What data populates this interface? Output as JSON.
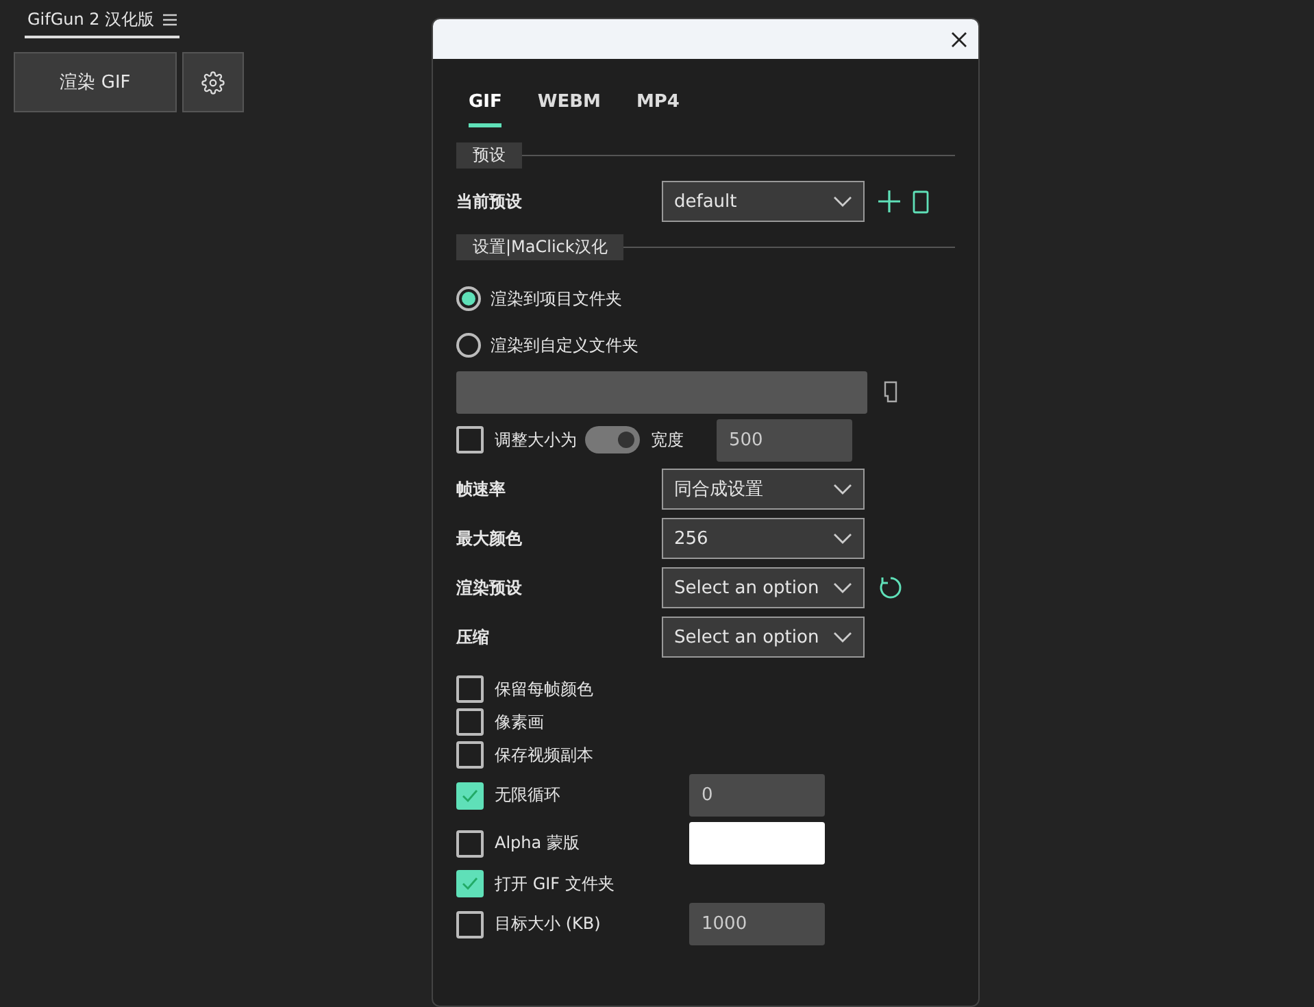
{
  "app": {
    "title": "GifGun 2 汉化版",
    "render_button": "渲染 GIF"
  },
  "dialog": {
    "tabs": [
      {
        "label": "GIF",
        "selected": true
      },
      {
        "label": "WEBM",
        "selected": false
      },
      {
        "label": "MP4",
        "selected": false
      }
    ],
    "preset_section": {
      "heading": "预设",
      "label": "当前预设",
      "value": "default"
    },
    "settings_section": {
      "heading": "设置|MaClick汉化"
    },
    "output": [
      {
        "label": "渲染到项目文件夹",
        "selected": true
      },
      {
        "label": "渲染到自定义文件夹",
        "selected": false
      }
    ],
    "resize": {
      "label": "调整大小为",
      "checked": false,
      "switch_on": true,
      "width_label": "宽度",
      "width_value": "500"
    },
    "selects": [
      {
        "label": "帧速率",
        "value": "同合成设置",
        "kind": "select"
      },
      {
        "label": "最大颜色",
        "value": "256",
        "kind": "select"
      },
      {
        "label": "渲染预设",
        "value": "Select an option",
        "kind": "refresh"
      },
      {
        "label": "压缩",
        "value": "Select an option",
        "kind": "select"
      }
    ],
    "options": [
      {
        "label": "保留每帧颜色",
        "checked": false,
        "kind": "plain"
      },
      {
        "label": "像素画",
        "checked": false,
        "kind": "plain"
      },
      {
        "label": "保存视频副本",
        "checked": false,
        "kind": "plain"
      },
      {
        "label": "无限循环",
        "checked": true,
        "kind": "number",
        "value": "0"
      },
      {
        "label": "Alpha 蒙版",
        "checked": false,
        "kind": "color",
        "color": "#ffffff"
      },
      {
        "label": "打开 GIF 文件夹",
        "checked": true,
        "kind": "plain"
      },
      {
        "label": "目标大小 (KB)",
        "checked": false,
        "kind": "number",
        "value": "1000"
      }
    ]
  }
}
